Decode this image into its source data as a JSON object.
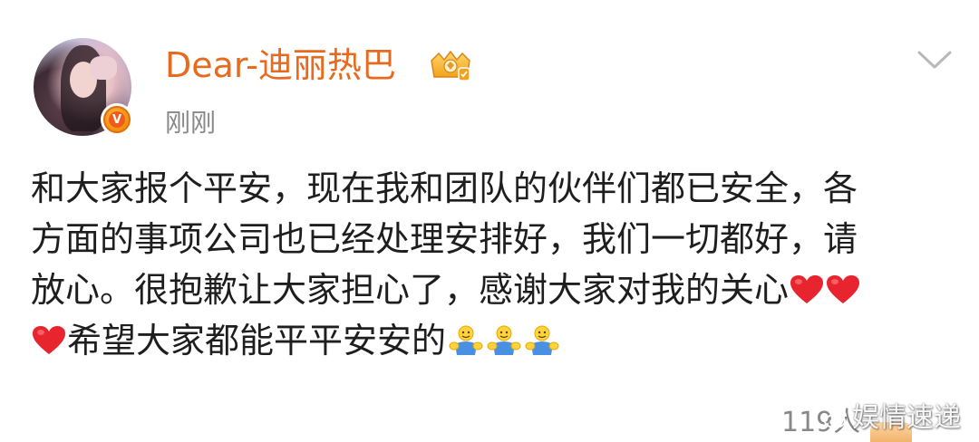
{
  "post": {
    "author": {
      "name": "Dear-迪丽热巴",
      "avatar_icon": "avatar-photo",
      "verified_icon": "verified-v-badge",
      "membership_icon": "crown-membership-icon",
      "accent_color": "#e86a1e"
    },
    "timestamp": "刚刚",
    "body_lines": [
      "和大家报个平安，现在我和团队的伙伴们都已安全，各",
      "方面的事项公司也已经处理安排好，我们一切都好，请",
      "放心。很抱歉让大家担心了，感谢大家对我的关心",
      "希望大家都能平平安安的"
    ],
    "emojis": {
      "heart": "red-heart-icon",
      "hug": "hug-emoji-icon"
    },
    "menu_icon": "chevron-down-icon"
  },
  "footer": {
    "count": "119人",
    "watermark": "娱情速递"
  }
}
